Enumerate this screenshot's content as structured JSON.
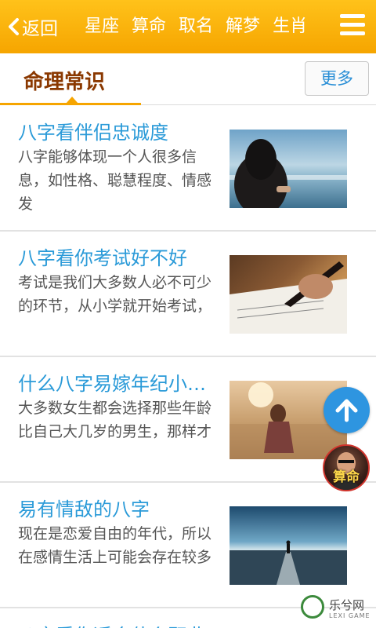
{
  "topbar": {
    "back_label": "返回",
    "nav": [
      "星座",
      "算命",
      "取名",
      "解梦",
      "生肖"
    ],
    "menu_icon": "hamburger-menu-icon"
  },
  "section": {
    "title": "命理常识",
    "more_label": "更多"
  },
  "articles": [
    {
      "title": "八字看伴侣忠诚度",
      "desc": "八字能够体现一个人很多信息，如性格、聪慧程度、情感发"
    },
    {
      "title": "八字看你考试好不好",
      "desc": "考试是我们大多数人必不可少的环节，从小学就开始考试，"
    },
    {
      "title": "什么八字易嫁年纪小…",
      "desc": "大多数女生都会选择那些年龄比自己大几岁的男生，那样才"
    },
    {
      "title": "易有情敌的八字",
      "desc": "现在是恋爱自由的年代，所以在感情生活上可能会存在较多"
    }
  ],
  "next_article_title_partial": "八字看你适合什么职业",
  "floating": {
    "avatar_label": "算命"
  },
  "watermark": {
    "text": "乐兮网",
    "sub": "LEXI GAME"
  },
  "colors": {
    "topbar": "#f6a500",
    "link_blue": "#2a9ad8",
    "section_title": "#8a3800",
    "fab_blue": "#2e95e0"
  }
}
